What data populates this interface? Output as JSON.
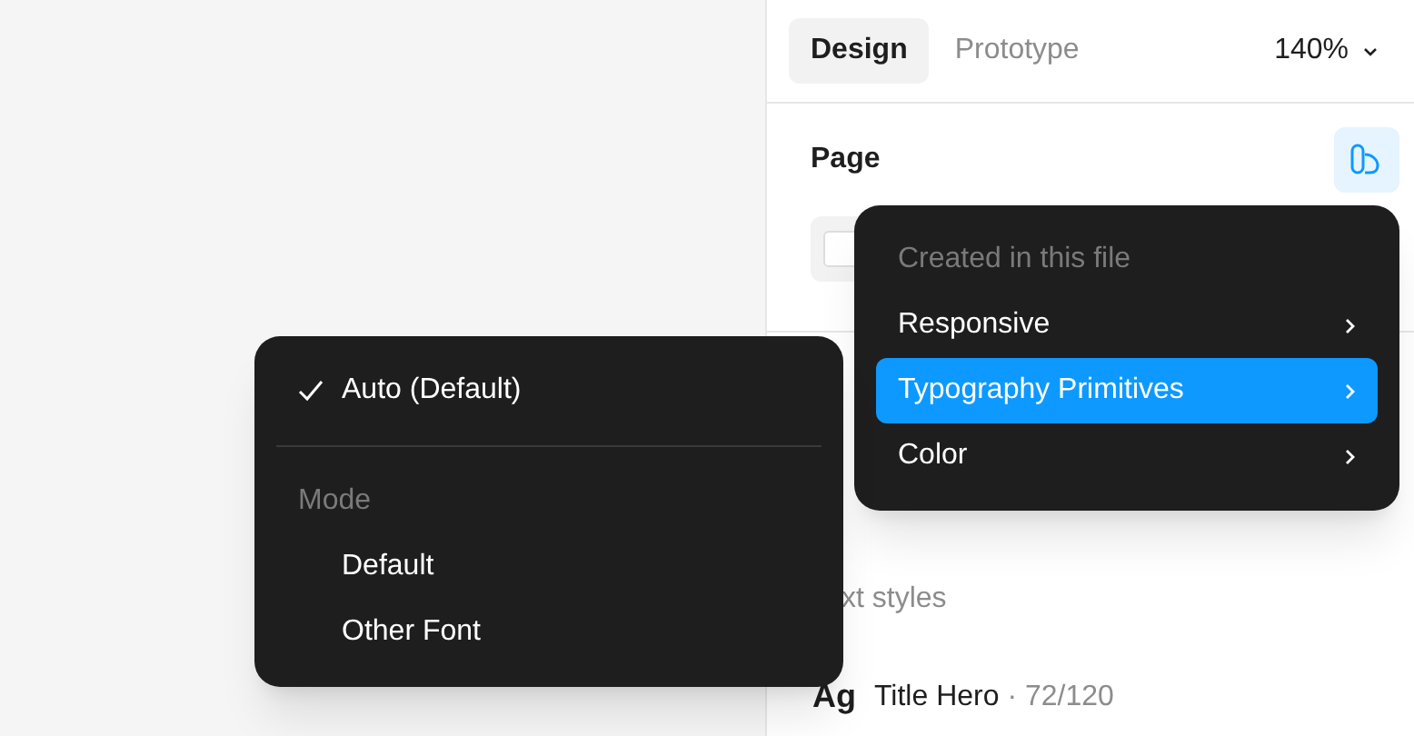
{
  "panel": {
    "tabs": [
      {
        "label": "Design",
        "selected": true
      },
      {
        "label": "Prototype",
        "selected": false
      }
    ],
    "zoom": "140%",
    "page_section": {
      "title": "Page"
    },
    "text_styles": {
      "heading": "xt styles",
      "items": [
        {
          "sample": "Ag",
          "name": "Title Hero",
          "spec": "· 72/120"
        }
      ]
    }
  },
  "library_menu": {
    "heading": "Created in this file",
    "items": [
      {
        "label": "Responsive",
        "selected": false
      },
      {
        "label": "Typography Primitives",
        "selected": true
      },
      {
        "label": "Color",
        "selected": false
      }
    ]
  },
  "mode_menu": {
    "top": {
      "label": "Auto (Default)",
      "checked": true
    },
    "heading": "Mode",
    "items": [
      {
        "label": "Default",
        "checked": false
      },
      {
        "label": "Other Font",
        "checked": false
      }
    ]
  }
}
